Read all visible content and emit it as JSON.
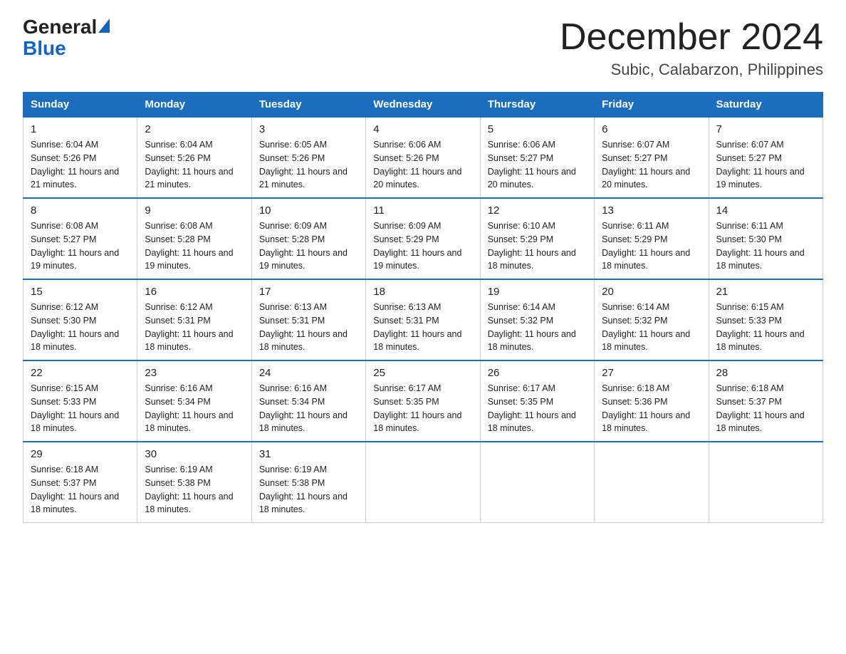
{
  "logo": {
    "general": "General",
    "blue": "Blue"
  },
  "header": {
    "title": "December 2024",
    "subtitle": "Subic, Calabarzon, Philippines"
  },
  "days_of_week": [
    "Sunday",
    "Monday",
    "Tuesday",
    "Wednesday",
    "Thursday",
    "Friday",
    "Saturday"
  ],
  "weeks": [
    [
      {
        "day": "1",
        "sunrise": "6:04 AM",
        "sunset": "5:26 PM",
        "daylight": "11 hours and 21 minutes."
      },
      {
        "day": "2",
        "sunrise": "6:04 AM",
        "sunset": "5:26 PM",
        "daylight": "11 hours and 21 minutes."
      },
      {
        "day": "3",
        "sunrise": "6:05 AM",
        "sunset": "5:26 PM",
        "daylight": "11 hours and 21 minutes."
      },
      {
        "day": "4",
        "sunrise": "6:06 AM",
        "sunset": "5:26 PM",
        "daylight": "11 hours and 20 minutes."
      },
      {
        "day": "5",
        "sunrise": "6:06 AM",
        "sunset": "5:27 PM",
        "daylight": "11 hours and 20 minutes."
      },
      {
        "day": "6",
        "sunrise": "6:07 AM",
        "sunset": "5:27 PM",
        "daylight": "11 hours and 20 minutes."
      },
      {
        "day": "7",
        "sunrise": "6:07 AM",
        "sunset": "5:27 PM",
        "daylight": "11 hours and 19 minutes."
      }
    ],
    [
      {
        "day": "8",
        "sunrise": "6:08 AM",
        "sunset": "5:27 PM",
        "daylight": "11 hours and 19 minutes."
      },
      {
        "day": "9",
        "sunrise": "6:08 AM",
        "sunset": "5:28 PM",
        "daylight": "11 hours and 19 minutes."
      },
      {
        "day": "10",
        "sunrise": "6:09 AM",
        "sunset": "5:28 PM",
        "daylight": "11 hours and 19 minutes."
      },
      {
        "day": "11",
        "sunrise": "6:09 AM",
        "sunset": "5:29 PM",
        "daylight": "11 hours and 19 minutes."
      },
      {
        "day": "12",
        "sunrise": "6:10 AM",
        "sunset": "5:29 PM",
        "daylight": "11 hours and 18 minutes."
      },
      {
        "day": "13",
        "sunrise": "6:11 AM",
        "sunset": "5:29 PM",
        "daylight": "11 hours and 18 minutes."
      },
      {
        "day": "14",
        "sunrise": "6:11 AM",
        "sunset": "5:30 PM",
        "daylight": "11 hours and 18 minutes."
      }
    ],
    [
      {
        "day": "15",
        "sunrise": "6:12 AM",
        "sunset": "5:30 PM",
        "daylight": "11 hours and 18 minutes."
      },
      {
        "day": "16",
        "sunrise": "6:12 AM",
        "sunset": "5:31 PM",
        "daylight": "11 hours and 18 minutes."
      },
      {
        "day": "17",
        "sunrise": "6:13 AM",
        "sunset": "5:31 PM",
        "daylight": "11 hours and 18 minutes."
      },
      {
        "day": "18",
        "sunrise": "6:13 AM",
        "sunset": "5:31 PM",
        "daylight": "11 hours and 18 minutes."
      },
      {
        "day": "19",
        "sunrise": "6:14 AM",
        "sunset": "5:32 PM",
        "daylight": "11 hours and 18 minutes."
      },
      {
        "day": "20",
        "sunrise": "6:14 AM",
        "sunset": "5:32 PM",
        "daylight": "11 hours and 18 minutes."
      },
      {
        "day": "21",
        "sunrise": "6:15 AM",
        "sunset": "5:33 PM",
        "daylight": "11 hours and 18 minutes."
      }
    ],
    [
      {
        "day": "22",
        "sunrise": "6:15 AM",
        "sunset": "5:33 PM",
        "daylight": "11 hours and 18 minutes."
      },
      {
        "day": "23",
        "sunrise": "6:16 AM",
        "sunset": "5:34 PM",
        "daylight": "11 hours and 18 minutes."
      },
      {
        "day": "24",
        "sunrise": "6:16 AM",
        "sunset": "5:34 PM",
        "daylight": "11 hours and 18 minutes."
      },
      {
        "day": "25",
        "sunrise": "6:17 AM",
        "sunset": "5:35 PM",
        "daylight": "11 hours and 18 minutes."
      },
      {
        "day": "26",
        "sunrise": "6:17 AM",
        "sunset": "5:35 PM",
        "daylight": "11 hours and 18 minutes."
      },
      {
        "day": "27",
        "sunrise": "6:18 AM",
        "sunset": "5:36 PM",
        "daylight": "11 hours and 18 minutes."
      },
      {
        "day": "28",
        "sunrise": "6:18 AM",
        "sunset": "5:37 PM",
        "daylight": "11 hours and 18 minutes."
      }
    ],
    [
      {
        "day": "29",
        "sunrise": "6:18 AM",
        "sunset": "5:37 PM",
        "daylight": "11 hours and 18 minutes."
      },
      {
        "day": "30",
        "sunrise": "6:19 AM",
        "sunset": "5:38 PM",
        "daylight": "11 hours and 18 minutes."
      },
      {
        "day": "31",
        "sunrise": "6:19 AM",
        "sunset": "5:38 PM",
        "daylight": "11 hours and 18 minutes."
      },
      null,
      null,
      null,
      null
    ]
  ],
  "labels": {
    "sunrise": "Sunrise:",
    "sunset": "Sunset:",
    "daylight": "Daylight:"
  }
}
